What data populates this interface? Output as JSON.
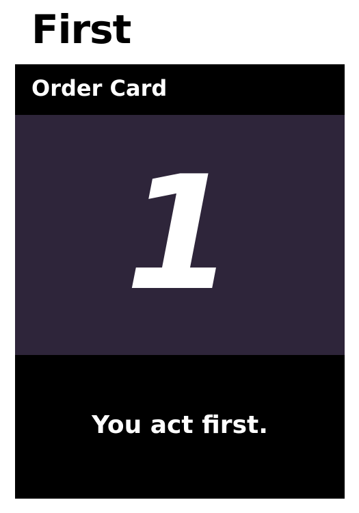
{
  "card": {
    "title": "First",
    "type": "Order Card",
    "order_number": "1",
    "text": "You act first.",
    "colors": {
      "frame": "#000000",
      "art_background": "#2e253a",
      "text": "#ffffff"
    }
  }
}
